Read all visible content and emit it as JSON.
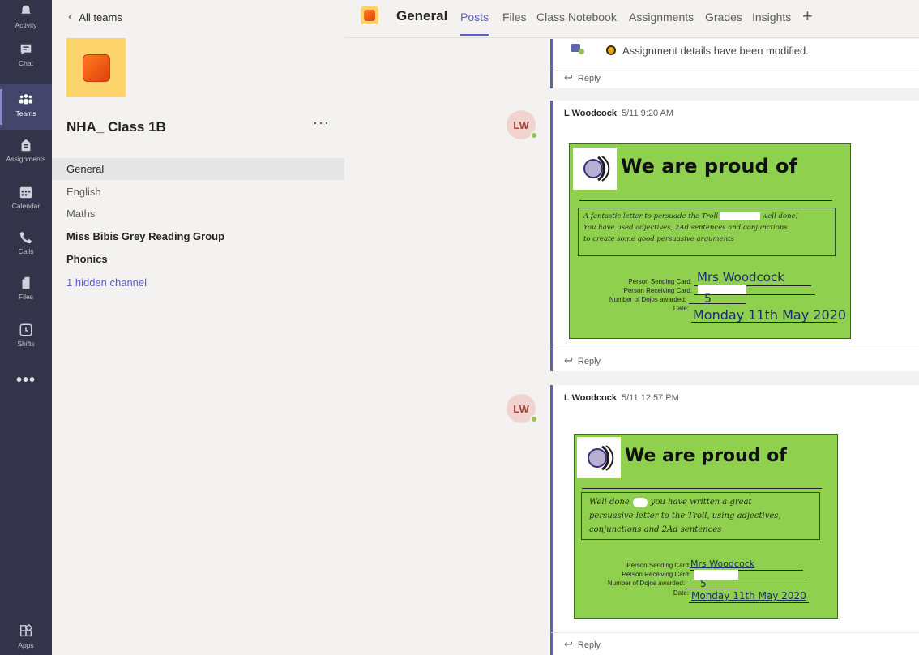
{
  "rail": {
    "items": [
      {
        "label": "Activity",
        "icon": "bell-icon"
      },
      {
        "label": "Chat",
        "icon": "chat-icon"
      },
      {
        "label": "Teams",
        "icon": "teams-icon"
      },
      {
        "label": "Assignments",
        "icon": "assignments-icon"
      },
      {
        "label": "Calendar",
        "icon": "calendar-icon"
      },
      {
        "label": "Calls",
        "icon": "phone-icon"
      },
      {
        "label": "Files",
        "icon": "file-icon"
      },
      {
        "label": "Shifts",
        "icon": "clock-icon"
      }
    ],
    "more": "•••",
    "apps_label": "Apps"
  },
  "team": {
    "back_label": "All teams",
    "name": "NHA_ Class 1B",
    "more": "···",
    "channels": [
      {
        "label": "General",
        "active": true
      },
      {
        "label": "English"
      },
      {
        "label": "Maths"
      },
      {
        "label": "Miss Bibis Grey Reading Group",
        "bold": true
      },
      {
        "label": "Phonics",
        "bold": true
      },
      {
        "label": "1 hidden channel",
        "link": true
      }
    ]
  },
  "header": {
    "channel": "General",
    "tabs": [
      "Posts",
      "Files",
      "Class Notebook",
      "Assignments",
      "Grades",
      "Insights"
    ],
    "active_tab": "Posts",
    "add": "+"
  },
  "posts": [
    {
      "system_message": "Assignment details have been modified.",
      "reply_label": "Reply"
    },
    {
      "initials": "LW",
      "author": "L Woodcock",
      "time": "5/11 9:20 AM",
      "reply_label": "Reply",
      "card": {
        "heading": "We are proud of",
        "message_lines": [
          "A fantastic letter to persuade the Troll",
          "well done!",
          "You have used adjectives, 2Ad sentences and conjunctions",
          "to create some good persuasive arguments"
        ],
        "labels": [
          "Person Sending Card:",
          "Person Receiving Card:",
          "Number of Dojos awarded:",
          "Date:"
        ],
        "sender": "Mrs Woodcock",
        "dojos": "5",
        "date": "Monday 11th May 2020"
      }
    },
    {
      "initials": "LW",
      "author": "L Woodcock",
      "time": "5/11 12:57 PM",
      "reply_label": "Reply",
      "card": {
        "heading": "We are proud of",
        "message_lines": [
          "Well done",
          "you have written a great",
          "persuasive letter to the Troll, using adjectives,",
          "conjunctions and 2Ad sentences"
        ],
        "labels": [
          "Person Sending Card:",
          "Person Receiving Card:",
          "Number of Dojos awarded:",
          "Date:"
        ],
        "sender": "Mrs Woodcock",
        "dojos": "5",
        "date": "Monday 11th May 2020"
      }
    }
  ],
  "colors": {
    "rail": "#33344a",
    "accent": "#5b5fc7",
    "card_green": "#8fd14f",
    "team_tile": "#fdd36b"
  }
}
